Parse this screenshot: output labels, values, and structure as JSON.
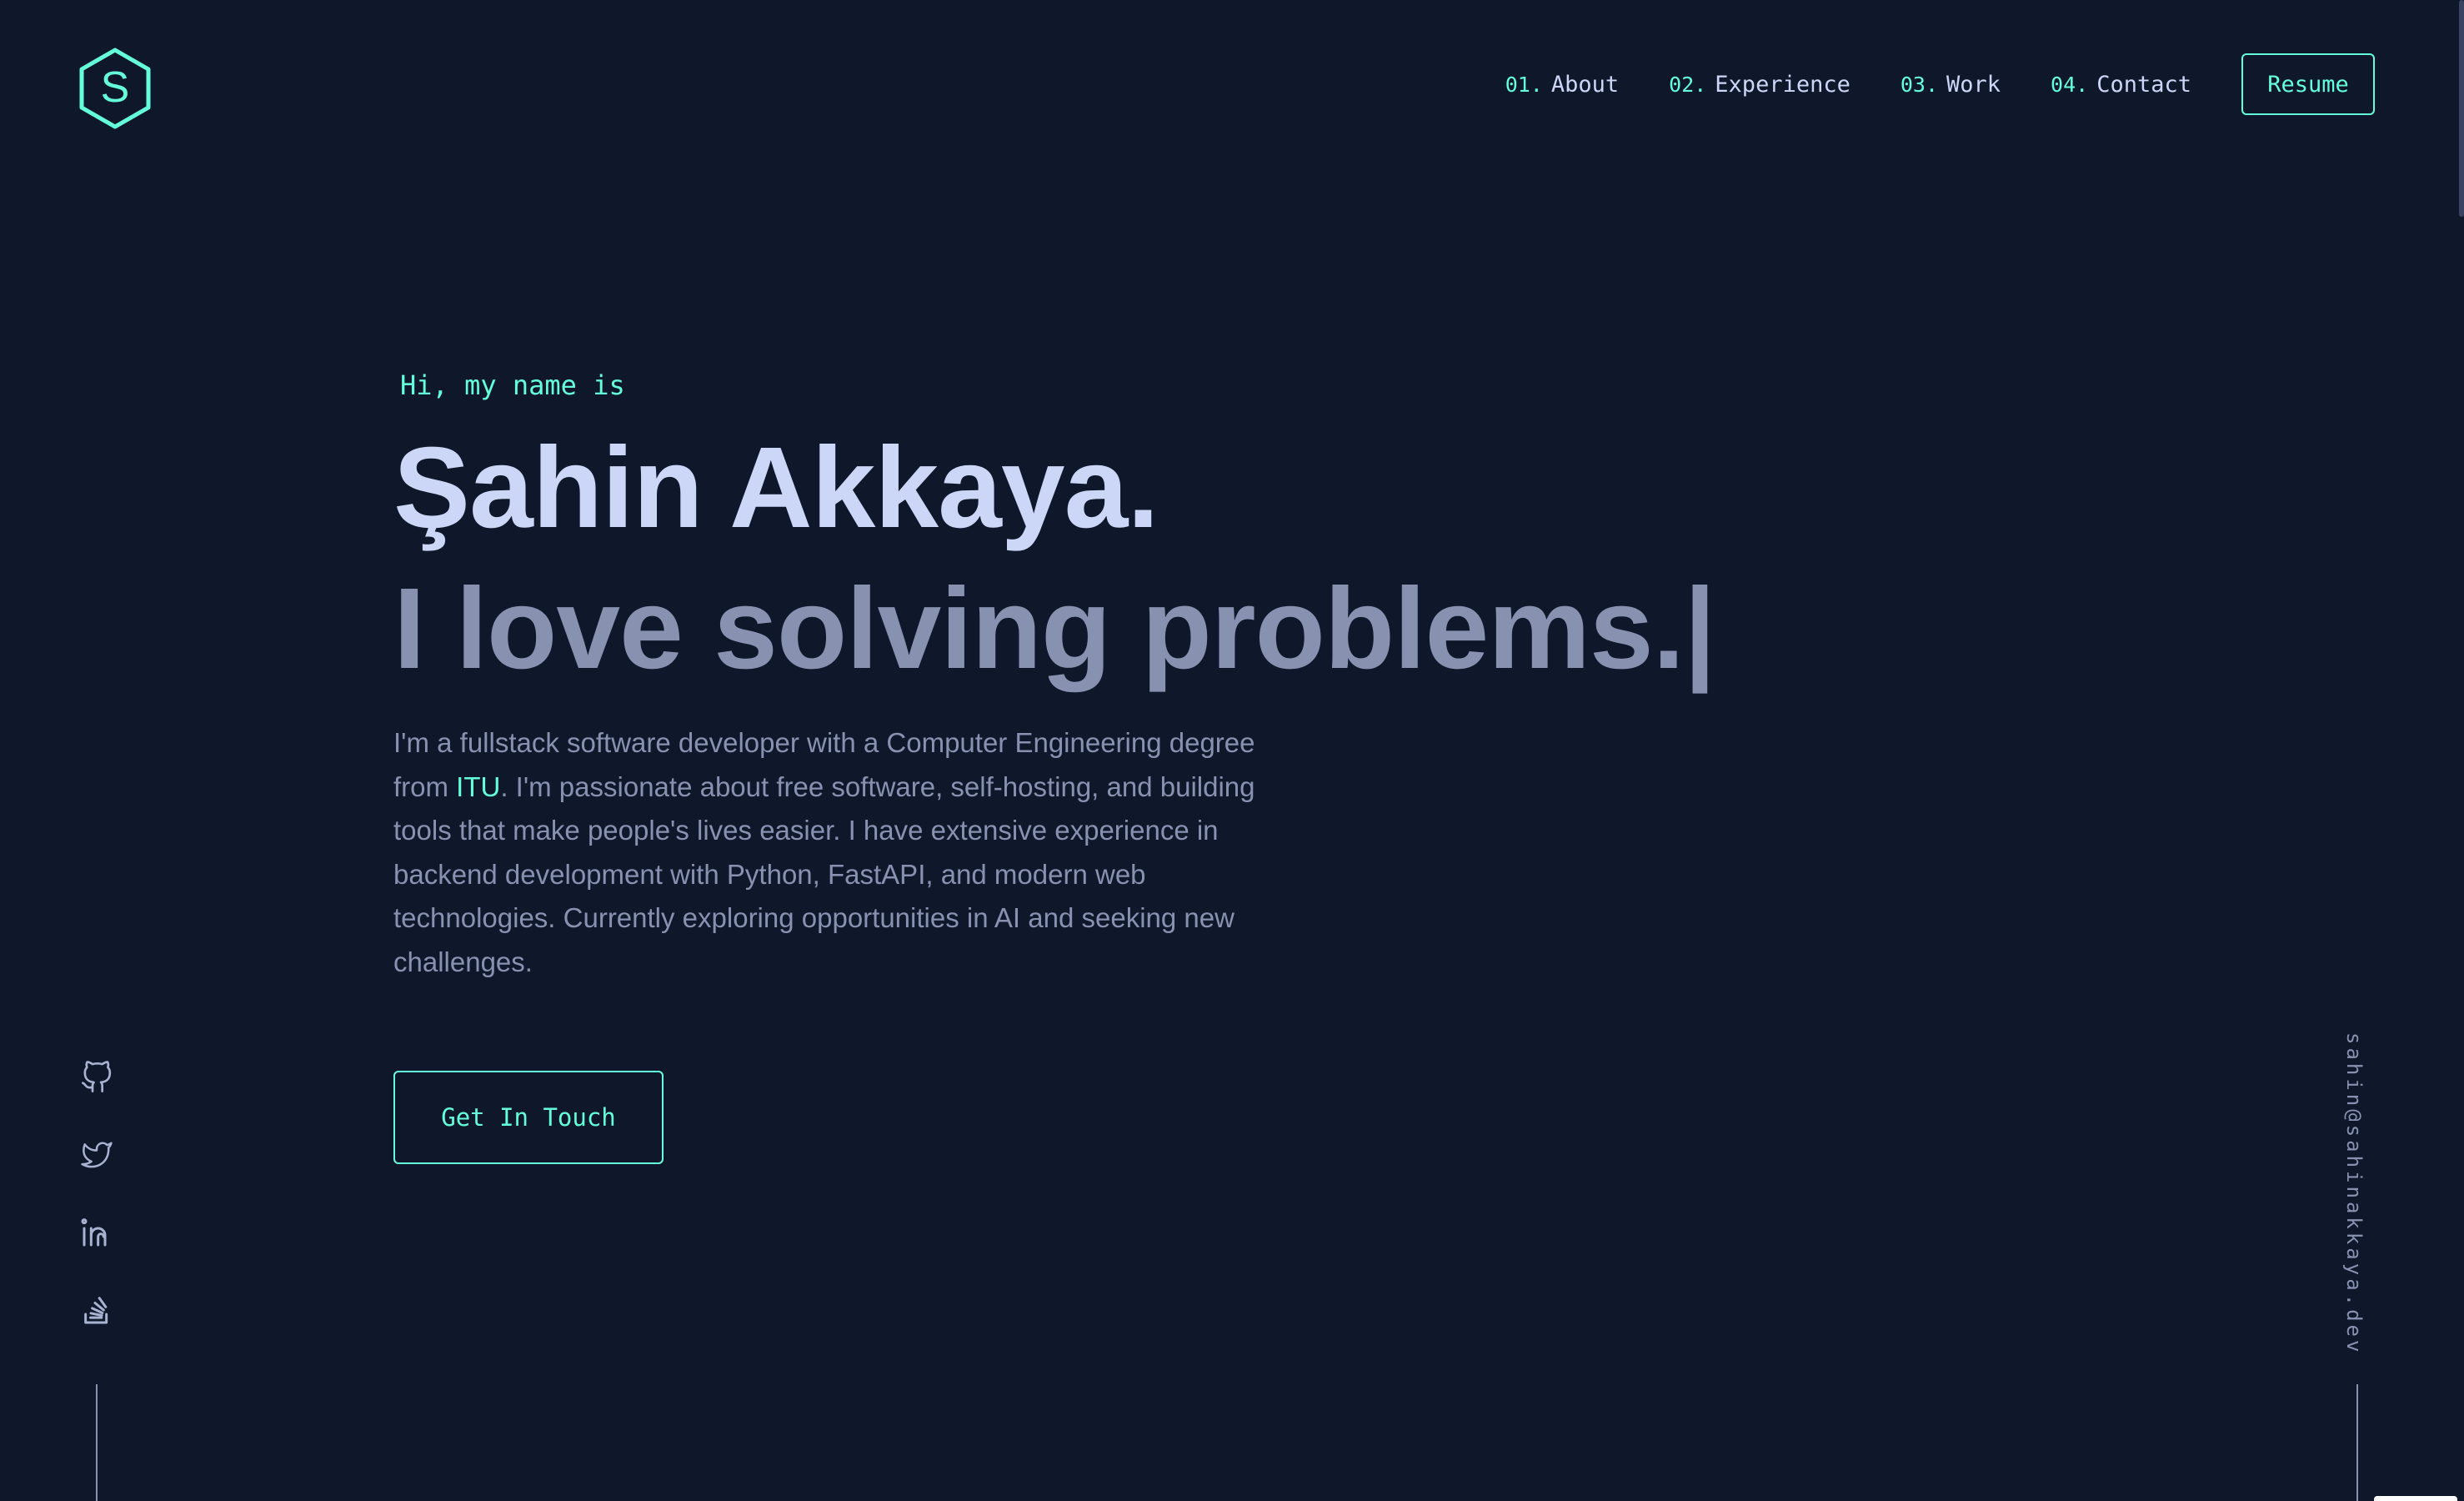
{
  "brand": {
    "logo_letter": "S",
    "accent_color": "#64ffda",
    "background_color": "#0f172a"
  },
  "nav": {
    "items": [
      {
        "num": "01.",
        "label": "About"
      },
      {
        "num": "02.",
        "label": "Experience"
      },
      {
        "num": "03.",
        "label": "Work"
      },
      {
        "num": "04.",
        "label": "Contact"
      }
    ],
    "resume_label": "Resume"
  },
  "hero": {
    "greeting": "Hi, my name is",
    "name": "Şahin Akkaya.",
    "tagline": "I love  solving problems.|",
    "bio_part1": "I'm a fullstack software developer with a Computer Engineering degree from ",
    "bio_link": "ITU",
    "bio_part2": ". I'm passionate about free software, self-hosting, and building tools that make people's lives easier. I have extensive experience in backend development with Python, FastAPI, and modern web technologies. Currently exploring opportunities in AI and seeking new challenges.",
    "cta_label": "Get In Touch"
  },
  "socials": [
    {
      "icon": "github-icon"
    },
    {
      "icon": "twitter-icon"
    },
    {
      "icon": "linkedin-icon"
    },
    {
      "icon": "stackoverflow-icon"
    }
  ],
  "email": "sahin@sahinakkaya.dev"
}
